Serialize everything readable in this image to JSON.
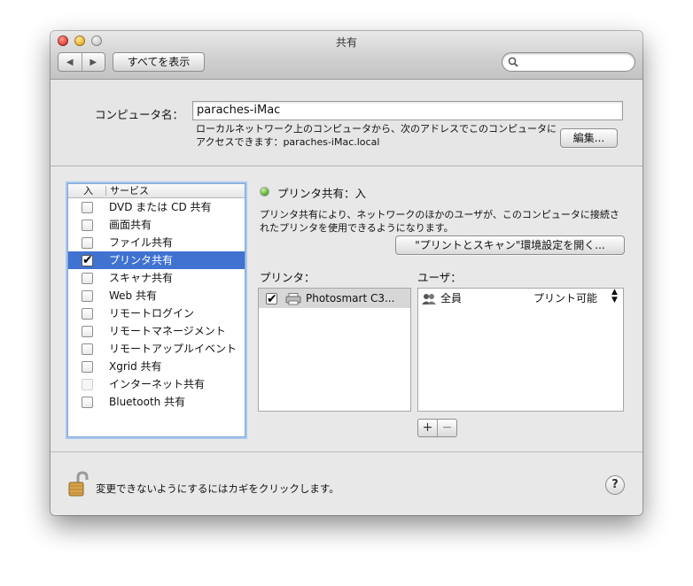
{
  "window": {
    "title": "共有"
  },
  "toolbar": {
    "back_label": "◀",
    "forward_label": "▶",
    "show_all_label": "すべてを表示",
    "search_placeholder": ""
  },
  "computer": {
    "name_label": "コンピュータ名：",
    "name_value": "paraches-iMac",
    "address_line1": "ローカルネットワーク上のコンピュータから、次のアドレスでこのコンピュータに",
    "address_line2": "アクセスできます：paraches-iMac.local",
    "edit_label": "編集..."
  },
  "services": {
    "col_on": "入",
    "col_service": "サービス",
    "items": [
      {
        "label": "DVD または CD 共有",
        "checked": false,
        "selected": false,
        "enabled": true
      },
      {
        "label": "画面共有",
        "checked": false,
        "selected": false,
        "enabled": true
      },
      {
        "label": "ファイル共有",
        "checked": false,
        "selected": false,
        "enabled": true
      },
      {
        "label": "プリンタ共有",
        "checked": true,
        "selected": true,
        "enabled": true
      },
      {
        "label": "スキャナ共有",
        "checked": false,
        "selected": false,
        "enabled": true
      },
      {
        "label": "Web 共有",
        "checked": false,
        "selected": false,
        "enabled": true
      },
      {
        "label": "リモートログイン",
        "checked": false,
        "selected": false,
        "enabled": true
      },
      {
        "label": "リモートマネージメント",
        "checked": false,
        "selected": false,
        "enabled": true
      },
      {
        "label": "リモートアップルイベント",
        "checked": false,
        "selected": false,
        "enabled": true
      },
      {
        "label": "Xgrid 共有",
        "checked": false,
        "selected": false,
        "enabled": true
      },
      {
        "label": "インターネット共有",
        "checked": false,
        "selected": false,
        "enabled": false
      },
      {
        "label": "Bluetooth 共有",
        "checked": false,
        "selected": false,
        "enabled": true
      }
    ]
  },
  "detail": {
    "status": "プリンタ共有：入",
    "status_color": "#4fa51f",
    "description_line1": "プリンタ共有により、ネットワークのほかのユーザが、このコンピュータに接続さ",
    "description_line2": "れたプリンタを使用できるようになります。",
    "open_prefs_label": "\"プリントとスキャン\"環境設定を開く...",
    "printers_label": "プリンタ：",
    "users_label": "ユーザ：",
    "printers": [
      {
        "label": "Photosmart C3...",
        "checked": true,
        "icon": "printer-icon"
      }
    ],
    "users": [
      {
        "label": "全員",
        "permission": "プリント可能",
        "icon": "group-icon"
      }
    ],
    "add_label": "+",
    "remove_label": "−"
  },
  "footer": {
    "lock_text": "変更できないようにするにはカギをクリックします。",
    "help_label": "?"
  },
  "colors": {
    "selection": "#3f72d1",
    "focus_ring": "#a9c7ee"
  }
}
